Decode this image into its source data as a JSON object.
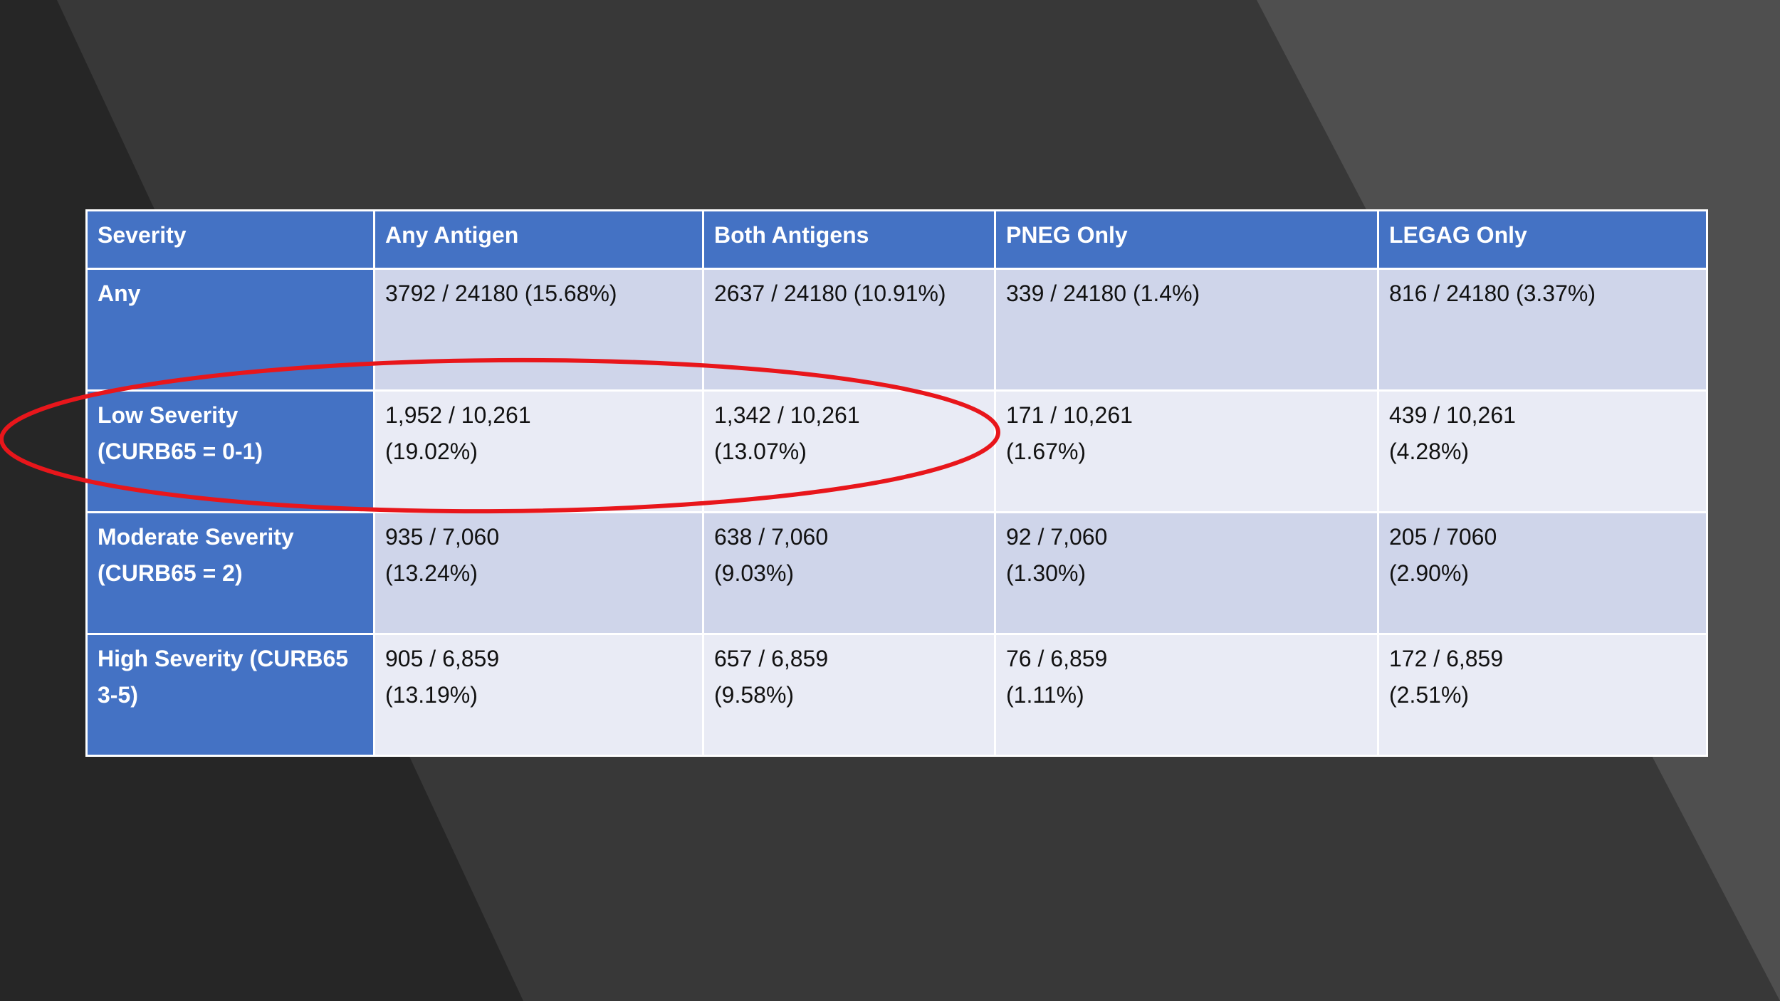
{
  "colors": {
    "background_dark": "#262626",
    "background_mid": "#383838",
    "background_light": "#4f4f4f",
    "header_blue": "#4472c4",
    "row_band_dark": "#cfd5ea",
    "row_band_light": "#e9ebf5",
    "annotation_red": "#e8161b"
  },
  "table": {
    "headers": [
      "Severity",
      "Any Antigen",
      "Both Antigens",
      "PNEG Only",
      "LEGAG Only"
    ],
    "rows": [
      {
        "label": "Any",
        "cells": [
          "3792 / 24180 (15.68%)",
          "2637 / 24180 (10.91%)",
          "339 / 24180 (1.4%)",
          "816 / 24180 (3.37%)"
        ]
      },
      {
        "label": "Low Severity\n(CURB65 = 0-1)",
        "cells": [
          "1,952 / 10,261\n(19.02%)",
          "1,342 / 10,261\n(13.07%)",
          "171 / 10,261\n(1.67%)",
          "439 / 10,261\n(4.28%)"
        ]
      },
      {
        "label": "Moderate Severity\n(CURB65 = 2)",
        "cells": [
          "935 / 7,060\n(13.24%)",
          "638 / 7,060\n(9.03%)",
          "92 / 7,060\n(1.30%)",
          "205 / 7060\n(2.90%)"
        ]
      },
      {
        "label": "High Severity (CURB65\n3-5)",
        "cells": [
          "905 / 6,859\n(13.19%)",
          "657 / 6,859\n(9.58%)",
          "76 / 6,859\n(1.11%)",
          "172 / 6,859\n(2.51%)"
        ]
      }
    ]
  }
}
